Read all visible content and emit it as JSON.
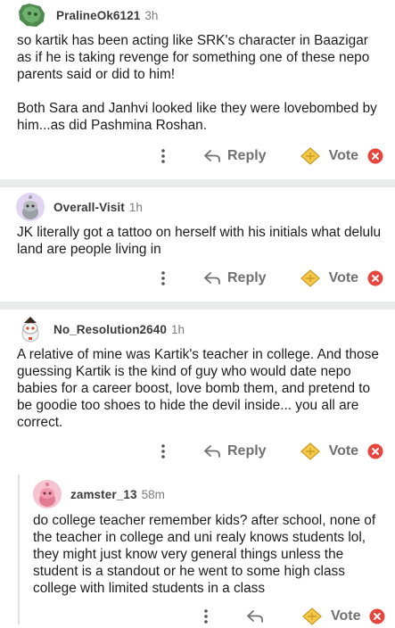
{
  "comments": [
    {
      "username": "PralineOk6121",
      "age": "3h",
      "body": [
        "so kartik has been acting like SRK's character in Baazigar as if he is taking revenge for something one of these nepo parents said or did to him!",
        "Both Sara and Janhvi looked like they were lovebombed by him...as did Pashmina Roshan."
      ],
      "reply_label": "Reply",
      "vote_label": "Vote"
    },
    {
      "username": "Overall-Visit",
      "age": "1h",
      "body": [
        "JK literally got a tattoo on herself with his initials what delulu land are people living in"
      ],
      "reply_label": "Reply",
      "vote_label": "Vote"
    },
    {
      "username": "No_Resolution2640",
      "age": "1h",
      "body": [
        "A relative of mine was Kartik's teacher in college. And those guessing Kartik is the kind of guy who would date nepo babies for a career boost, love bomb them, and pretend to be goodie too shoes to hide the devil inside... you all are correct."
      ],
      "reply_label": "Reply",
      "vote_label": "Vote"
    },
    {
      "username": "zamster_13",
      "age": "58m",
      "body": [
        "do college teacher remember kids? after school, none of the teacher in college and uni realy knows students lol, they might just know very general things unless the student is a standout or he went to some high class college with limited students in a class"
      ],
      "vote_label": "Vote"
    }
  ],
  "colors": {
    "divider": "#e9ebec",
    "action_gray": "#707070",
    "coin_fill": "#f6c94a",
    "remove_red": "#e8453c"
  },
  "icons": {
    "more": "more-vertical-icon",
    "reply": "reply-arrow-icon",
    "vote": "vote-coin-icon",
    "remove": "remove-x-icon"
  }
}
